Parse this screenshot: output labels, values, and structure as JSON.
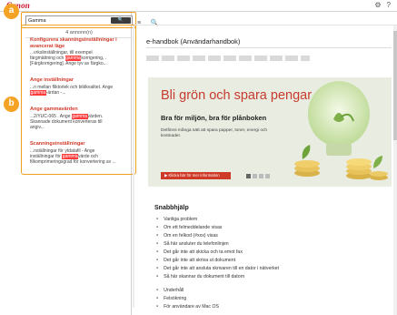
{
  "app": {
    "logo": "Canon"
  },
  "toolbar": {
    "settings_icon": "⚙",
    "help_icon": "?",
    "collapse_icon": "≡",
    "search_icon": "🔍"
  },
  "search": {
    "value": "Gamma",
    "button_icon": "🔍",
    "callout": "a"
  },
  "results": {
    "count": "4 annonn(n)",
    "callout": "b",
    "items": [
      {
        "title": "Konfigurera skanningsinställningar i avancerat läge",
        "line1": "...vrkslinställningar, till exempel",
        "line2a": "färgmättning och ",
        "hl": "gamma",
        "line2b": "korrigering, .",
        "line3": "[Färgkorrigering]. Ange tyv av färgko..."
      },
      {
        "title": "Ange inställningar",
        "line1": "...n mellan fliktorlek och bildkvalitet. Ange",
        "line2a": "",
        "hl": "gamma",
        "line2b": "-ärdan -...",
        "line3": ""
      },
      {
        "title": "Ange gammavärden",
        "line1": "...2/YUC-065 . Ange ",
        "line2a": "",
        "hl": "gamma",
        "line2b": "värden.",
        "line3": "Skannade dokument konverteras till",
        "line4": "angiv..."
      },
      {
        "title": "Scanningsinställningar",
        "line1": "...nställningar för ytdatafil - Ange",
        "line2a": "inställningar för ",
        "hl": "gamma",
        "line2b": "värde och",
        "line3": "filkomprimeringsgrad för konvertering av ..."
      }
    ]
  },
  "main": {
    "title": "e-handbok (Användarhandbok)",
    "banner": {
      "headline": "Bli grön och spara pengar",
      "subtitle": "Bra för miljön, bra för plånboken",
      "body": "Detfinns många sätt att spara papper, toner, energi och kostnader.",
      "button": "▶ Klicka här för mer information"
    },
    "quickhelp_title": "Snabbhjälp",
    "quickhelp": [
      "Vanliga problem",
      "Om ett felmeddelande visas",
      "Om en felkod (#xxx) visas",
      "Så här ansluter du telefonlinjen",
      "Det går inte att skicka och ta emot fax",
      "Det går inte att skriva ut dokument",
      "Det går inte att ansluta skrivaren till en dator i nätverket",
      "Så här skannar du dokument till datorn"
    ],
    "extra": [
      "Underhåll",
      "Felsökning",
      "För användare av Mac OS"
    ]
  },
  "colors": {
    "brand": "#c8102e",
    "callout": "#f4a324",
    "highlight": "#ff3b3b",
    "result_title": "#d23a2a"
  }
}
